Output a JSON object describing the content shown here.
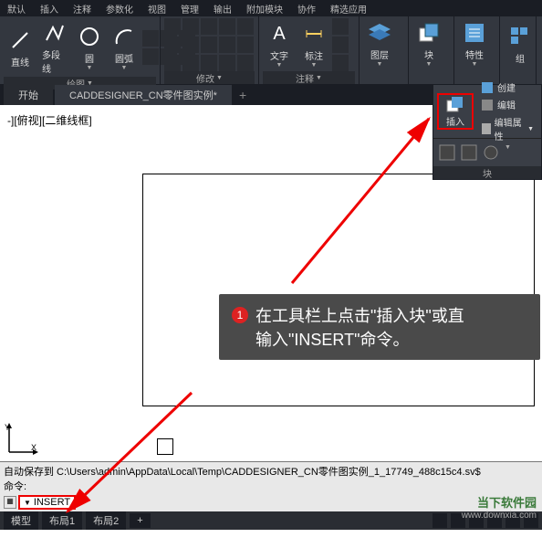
{
  "ribbon_tabs": [
    "默认",
    "插入",
    "注释",
    "参数化",
    "视图",
    "管理",
    "输出",
    "附加模块",
    "协作",
    "精选应用"
  ],
  "groups": {
    "draw": {
      "label": "绘图",
      "tools": [
        {
          "label": "直线"
        },
        {
          "label": "多段线"
        },
        {
          "label": "圆"
        },
        {
          "label": "圆弧"
        }
      ]
    },
    "modify": {
      "label": "修改"
    },
    "annotate": {
      "label": "注释",
      "text_tool": "文字",
      "dim_tool": "标注"
    },
    "layers": {
      "label": "图层"
    },
    "block": {
      "label": "块"
    },
    "props": {
      "label": "特性"
    },
    "group": {
      "label": "组"
    }
  },
  "doc_tabs": {
    "start": "开始",
    "file": "CADDESIGNER_CN零件图实例*"
  },
  "view_label": "-][俯视][二维线框]",
  "dropdown": {
    "insert": "插入",
    "items": [
      {
        "label": "创建"
      },
      {
        "label": "编辑"
      },
      {
        "label": "编辑属性"
      }
    ],
    "panel_label": "块"
  },
  "callout": {
    "num": "1",
    "line1": "在工具栏上点击\"插入块\"或直",
    "line2": "输入\"INSERT\"命令。"
  },
  "cmd": {
    "line1": "自动保存到 C:\\Users\\admin\\AppData\\Local\\Temp\\CADDESIGNER_CN零件图实例_1_17749_488c15c4.sv$",
    "line2": "命令:",
    "input": "INSERT"
  },
  "status": {
    "tabs": [
      "模型",
      "布局1",
      "布局2"
    ],
    "plus": "+"
  },
  "watermark": {
    "brand": "当下软件园",
    "url": "www.downxia.com"
  }
}
